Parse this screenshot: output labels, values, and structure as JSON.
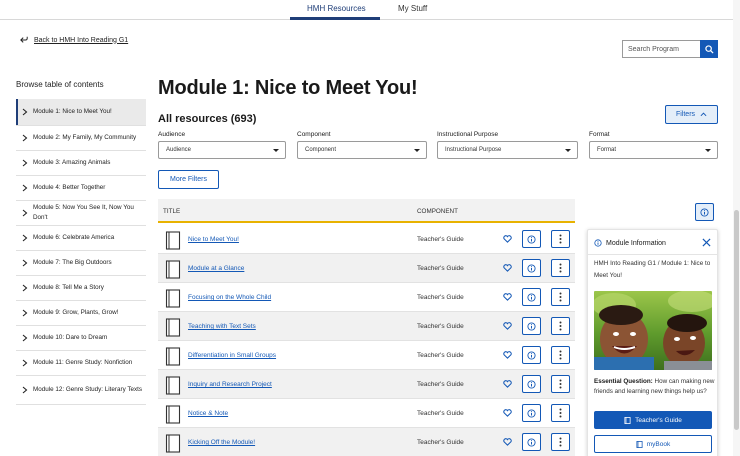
{
  "topnav": {
    "tabs": [
      {
        "label": "HMH Resources",
        "active": true
      },
      {
        "label": "My Stuff",
        "active": false
      }
    ]
  },
  "back_link": "Back to HMH Into Reading G1",
  "search": {
    "placeholder": "Search Program"
  },
  "sidebar": {
    "title": "Browse table of contents",
    "items": [
      {
        "label": "Module 1: Nice to Meet You!",
        "active": true
      },
      {
        "label": "Module 2: My Family, My Community"
      },
      {
        "label": "Module 3: Amazing Animals"
      },
      {
        "label": "Module 4: Better Together"
      },
      {
        "label": "Module 5: Now You See It, Now You Don't"
      },
      {
        "label": "Module 6: Celebrate America"
      },
      {
        "label": "Module 7: The Big Outdoors"
      },
      {
        "label": "Module 8: Tell Me a Story"
      },
      {
        "label": "Module 9: Grow, Plants, Grow!"
      },
      {
        "label": "Module 10: Dare to Dream"
      },
      {
        "label": "Module 11: Genre Study: Nonfiction"
      },
      {
        "label": "Module 12: Genre Study: Literary Texts"
      }
    ]
  },
  "main": {
    "title": "Module 1: Nice to Meet You!",
    "all_resources": "All resources (693)",
    "filters_button": "Filters",
    "more_filters": "More Filters",
    "filters": [
      {
        "label": "Audience",
        "value": "Audience"
      },
      {
        "label": "Component",
        "value": "Component"
      },
      {
        "label": "Instructional Purpose",
        "value": "Instructional Purpose"
      },
      {
        "label": "Format",
        "value": "Format"
      }
    ],
    "table": {
      "headers": {
        "title": "TITLE",
        "component": "COMPONENT"
      },
      "rows": [
        {
          "title": "Nice to Meet You!",
          "component": "Teacher's Guide"
        },
        {
          "title": "Module at a Glance",
          "component": "Teacher's Guide"
        },
        {
          "title": "Focusing on the Whole Child",
          "component": "Teacher's Guide"
        },
        {
          "title": "Teaching with Text Sets",
          "component": "Teacher's Guide"
        },
        {
          "title": "Differentiation in Small Groups",
          "component": "Teacher's Guide"
        },
        {
          "title": "Inquiry and Research Project",
          "component": "Teacher's Guide"
        },
        {
          "title": "Notice & Note",
          "component": "Teacher's Guide"
        },
        {
          "title": "Kicking Off the Module!",
          "component": "Teacher's Guide"
        }
      ]
    }
  },
  "panel": {
    "title": "Module Information",
    "breadcrumb": "HMH Into Reading G1 / Module 1: Nice to Meet You!",
    "eq_label": "Essential Question:",
    "eq_text": "How can making new friends and learning new things help us?",
    "teacher_guide_button": "Teacher's Guide",
    "mybook_button": "myBook"
  },
  "colors": {
    "accent": "#1358b6",
    "nav": "#1f3e78",
    "table_header_rule": "#e8b200"
  }
}
